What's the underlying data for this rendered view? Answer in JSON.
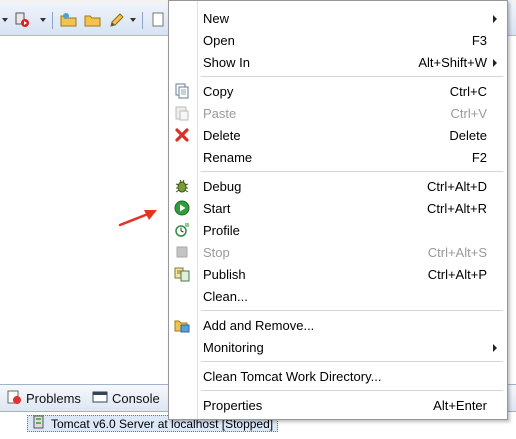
{
  "toolbar": {
    "icons": [
      "run-server-icon",
      "open-folder-icon",
      "folder-icon",
      "pencil-icon",
      "page-icon"
    ]
  },
  "bottom_panel": {
    "tabs": [
      {
        "label": "Problems",
        "icon": "problems-icon"
      },
      {
        "label": "Console",
        "icon": "console-icon"
      }
    ],
    "servers": [
      {
        "label": "Tomcat v6.0 Server at localhost  [Stopped]",
        "selected": true
      }
    ]
  },
  "context_menu": {
    "items": {
      "new": {
        "label": "New",
        "submenu": true
      },
      "open": {
        "label": "Open",
        "accel": "F3"
      },
      "show_in": {
        "label": "Show In",
        "accel": "Alt+Shift+W",
        "submenu": true
      },
      "copy": {
        "label": "Copy",
        "accel": "Ctrl+C",
        "icon": "copy-icon"
      },
      "paste": {
        "label": "Paste",
        "accel": "Ctrl+V",
        "icon": "paste-icon",
        "disabled": true
      },
      "delete": {
        "label": "Delete",
        "accel": "Delete",
        "icon": "delete-icon"
      },
      "rename": {
        "label": "Rename",
        "accel": "F2"
      },
      "debug": {
        "label": "Debug",
        "accel": "Ctrl+Alt+D",
        "icon": "debug-bug-icon"
      },
      "start": {
        "label": "Start",
        "accel": "Ctrl+Alt+R",
        "icon": "start-icon"
      },
      "profile": {
        "label": "Profile",
        "icon": "profile-icon"
      },
      "stop": {
        "label": "Stop",
        "accel": "Ctrl+Alt+S",
        "icon": "stop-icon",
        "disabled": true
      },
      "publish": {
        "label": "Publish",
        "accel": "Ctrl+Alt+P",
        "icon": "publish-icon"
      },
      "clean": {
        "label": "Clean..."
      },
      "add_remove": {
        "label": "Add and Remove...",
        "icon": "add-remove-icon"
      },
      "monitoring": {
        "label": "Monitoring",
        "submenu": true
      },
      "clean_tomcat": {
        "label": "Clean Tomcat Work Directory..."
      },
      "properties": {
        "label": "Properties",
        "accel": "Alt+Enter"
      }
    }
  },
  "colors": {
    "annotation_arrow": "#e53322",
    "menu_border": "#979797",
    "selection": "#dce8f8"
  }
}
